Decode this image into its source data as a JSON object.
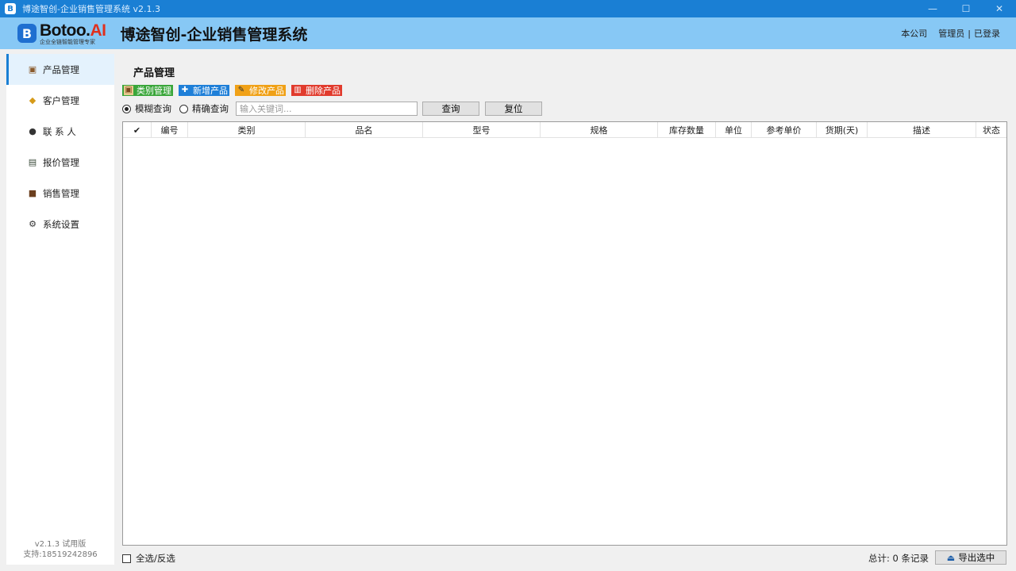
{
  "window": {
    "title": "博途智创-企业销售管理系统 v2.1.3",
    "app_icon": "B",
    "minimize": "—",
    "maximize": "☐",
    "close": "✕"
  },
  "header": {
    "logo_letter": "B",
    "logo_name": "Botoo",
    "logo_ai": "AI",
    "logo_dot": ".",
    "logo_slogan": "企业全链智能管理专家",
    "app_title": "博途智创-企业销售管理系统",
    "company": "本公司",
    "user": "管理员",
    "separator": "|",
    "status": "已登录"
  },
  "sidebar": {
    "items": [
      {
        "label": "产品管理",
        "icon": "box-icon",
        "glyph": "▣",
        "color": "#8a5a2b",
        "active": true
      },
      {
        "label": "客户管理",
        "icon": "handshake-icon",
        "glyph": "◆",
        "color": "#d69a18",
        "active": false
      },
      {
        "label": "联 系 人",
        "icon": "contacts-icon",
        "glyph": "●",
        "color": "#333333",
        "active": false
      },
      {
        "label": "报价管理",
        "icon": "quote-icon",
        "glyph": "▤",
        "color": "#3a4a3a",
        "active": false
      },
      {
        "label": "销售管理",
        "icon": "briefcase-icon",
        "glyph": "■",
        "color": "#6b3f1e",
        "active": false
      },
      {
        "label": "系统设置",
        "icon": "gear-icon",
        "glyph": "⚙",
        "color": "#333333",
        "active": false
      }
    ],
    "version": "v2.1.3  试用版",
    "support": "支持:18519242896"
  },
  "main": {
    "title": "产品管理",
    "toolbar": {
      "category": "类别管理",
      "add": "新增产品",
      "edit": "修改产品",
      "delete": "删除产品"
    },
    "search": {
      "fuzzy": "模糊查询",
      "exact": "精确查询",
      "placeholder": "输入关键词...",
      "value": "",
      "query_button": "查询",
      "reset_button": "复位",
      "mode": "fuzzy"
    },
    "table": {
      "check_header": "✔",
      "columns": [
        "编号",
        "类别",
        "品名",
        "型号",
        "规格",
        "库存数量",
        "单位",
        "参考单价",
        "货期(天)",
        "描述",
        "状态"
      ],
      "rows": []
    },
    "footer": {
      "select_all": "全选/反选",
      "total": "总计: 0 条记录",
      "export": "导出选中"
    }
  }
}
